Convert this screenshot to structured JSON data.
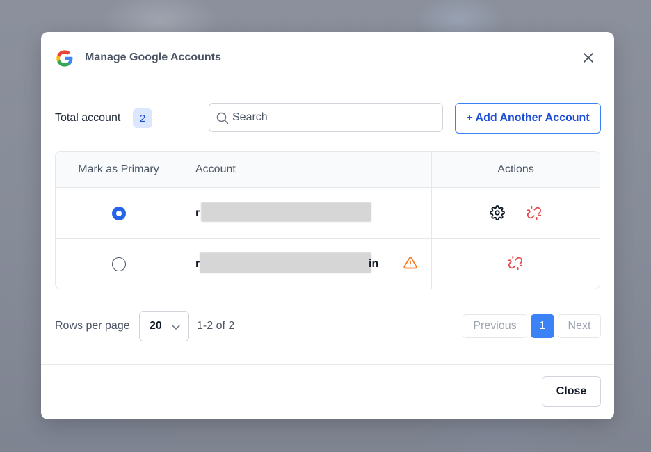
{
  "dialog": {
    "title": "Manage Google Accounts",
    "logo_icon": "google-g-icon",
    "close_icon": "close-icon"
  },
  "toolbar": {
    "total_label": "Total account",
    "total_count": "2",
    "search_placeholder": "Search",
    "search_value": "",
    "add_button_label": "+ Add Another Account"
  },
  "table": {
    "columns": [
      "Mark as Primary",
      "Account",
      "Actions"
    ],
    "rows": [
      {
        "primary": true,
        "account_prefix": "r",
        "account_suffix": "",
        "warning": false,
        "actions": [
          "gear-icon",
          "unlink-icon"
        ]
      },
      {
        "primary": false,
        "account_prefix": "r",
        "account_suffix": "in",
        "warning": true,
        "actions": [
          "unlink-icon"
        ]
      }
    ]
  },
  "pagination": {
    "rows_per_page_label": "Rows per page",
    "rows_per_page_value": "20",
    "range_text": "1-2 of 2",
    "previous_label": "Previous",
    "current_page": "1",
    "next_label": "Next"
  },
  "footer": {
    "close_label": "Close"
  },
  "colors": {
    "primary_blue": "#2563eb",
    "unlink_red": "#e5484d",
    "warning_orange": "#f97316"
  }
}
